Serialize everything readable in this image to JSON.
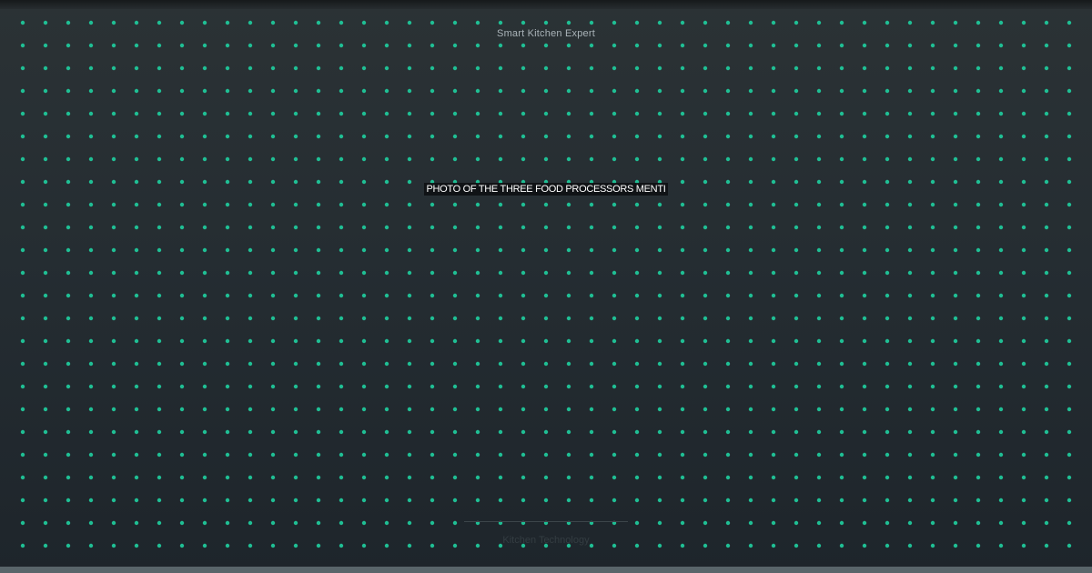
{
  "site_name": "Smart Kitchen Expert",
  "headline": "PHOTO OF THE THREE FOOD PROCESSORS MENTI",
  "footer": "Kitchen Technology",
  "colors": {
    "background": "#252d32",
    "dot_accent": "#1fbf94",
    "headline_text": "#ffffff",
    "headline_background": "#0c0e10",
    "bottom_bar": "#59656a"
  }
}
